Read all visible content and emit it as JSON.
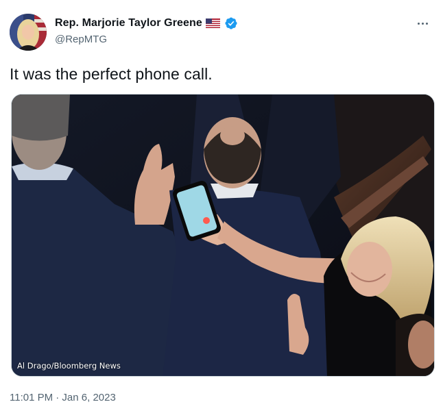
{
  "author": {
    "display_name": "Rep. Marjorie Taylor Greene",
    "handle": "@RepMTG",
    "verified": true
  },
  "tweet": {
    "text": "It was the perfect phone call.",
    "timestamp": "11:01 PM · Jan 6, 2023"
  },
  "media": {
    "photo_credit": "Al Drago/Bloomberg News"
  },
  "icons": {
    "flag": "us-flag-emoji",
    "verified": "verified-badge-icon",
    "more": "more-options-icon"
  },
  "colors": {
    "text_primary": "#0f1419",
    "text_secondary": "#536471",
    "verified_blue": "#1d9bf0",
    "border": "#cfd9de"
  }
}
